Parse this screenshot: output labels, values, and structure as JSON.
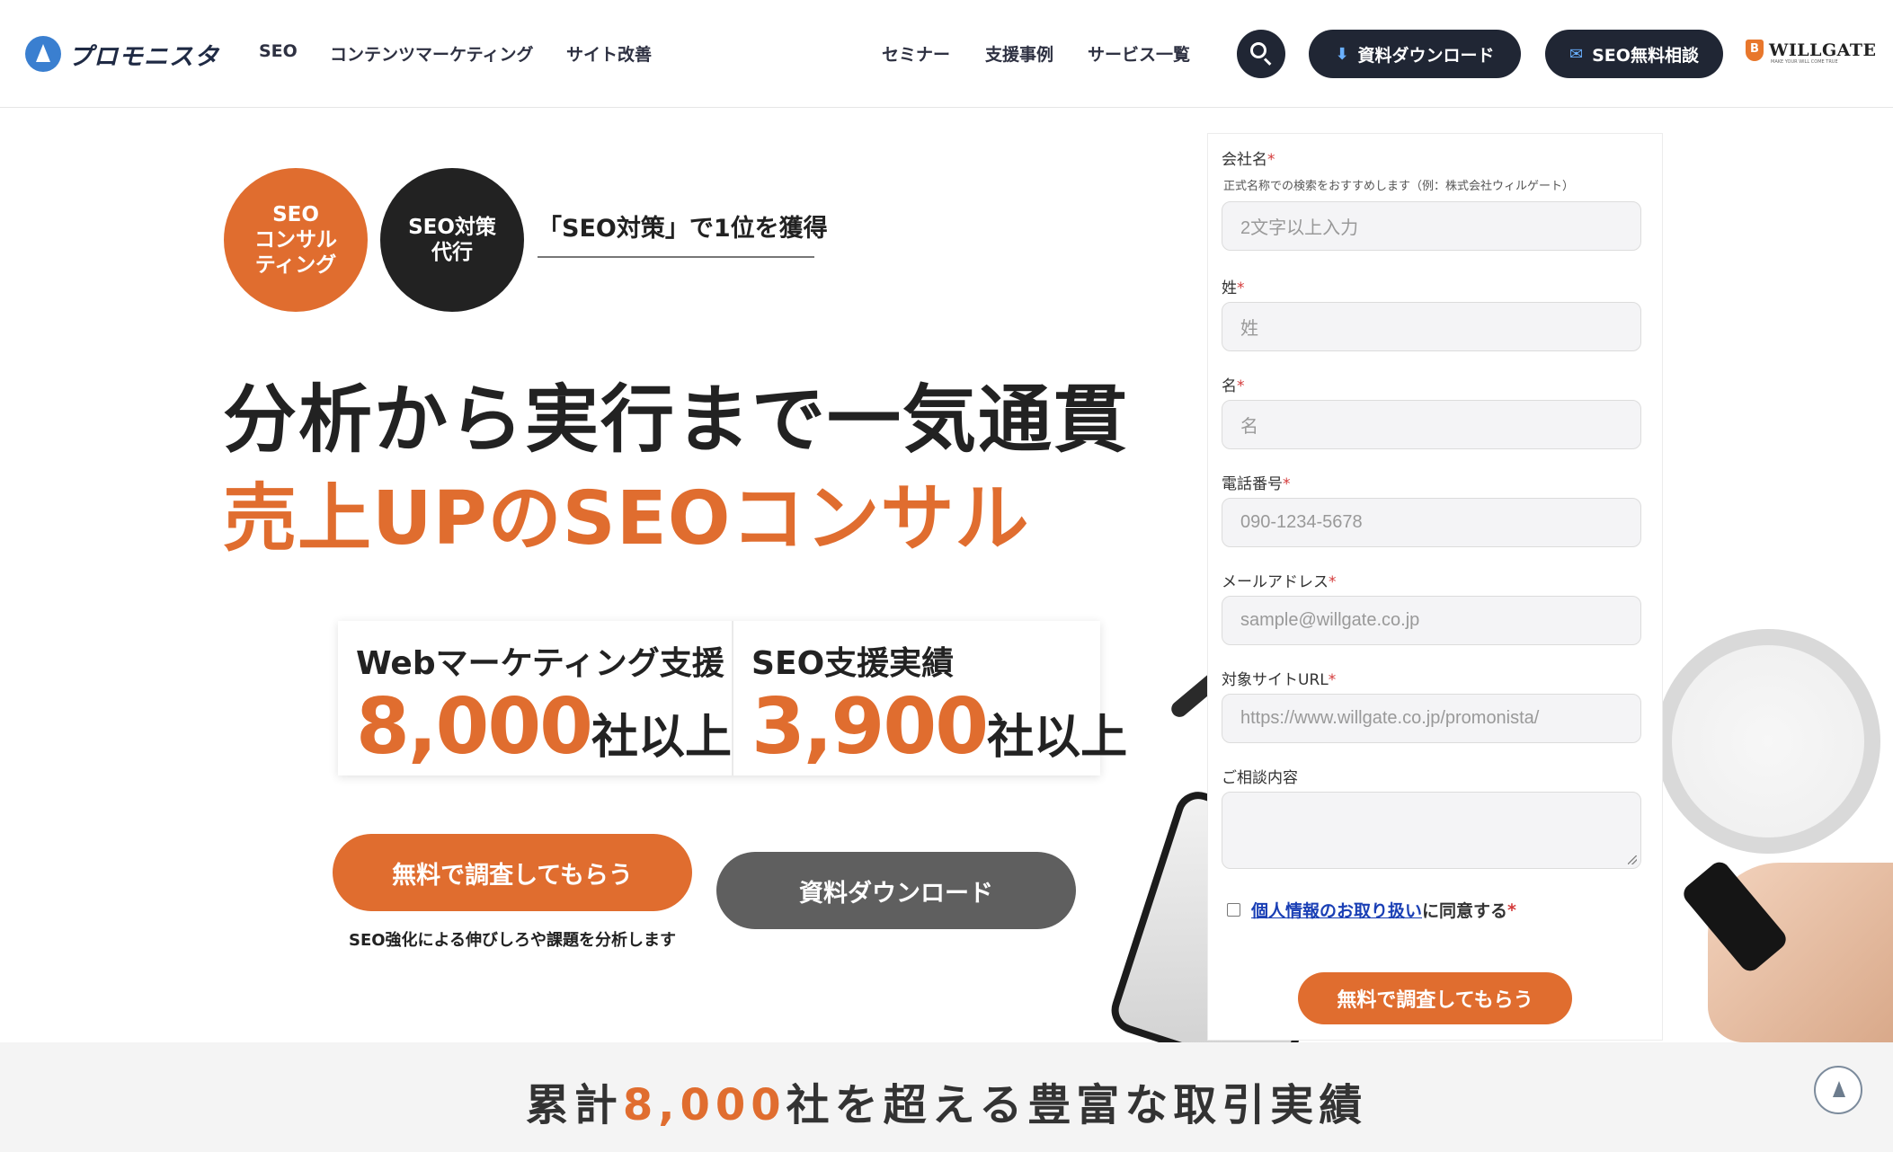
{
  "header": {
    "logo_text": "プロモニスタ",
    "nav_left": [
      "SEO",
      "コンテンツマーケティング",
      "サイト改善"
    ],
    "nav_right": [
      "セミナー",
      "支援事例",
      "サービス一覧"
    ],
    "download_button": "資料ダウンロード",
    "consult_button": "SEO無料相談",
    "company_logo": "WILLGATE",
    "company_tagline": "MAKE YOUR WILL COME TRUE"
  },
  "hero": {
    "badge_orange": "SEO\nコンサル\nティング",
    "badge_black": "SEO対策\n代行",
    "tagline": "「SEO対策」で1位を獲得",
    "headline_line1": "分析から実行まで一気通貫",
    "headline_line2": "売上UPのSEOコンサル",
    "stats": [
      {
        "label": "Webマーケティング支援",
        "number": "8,000",
        "unit": "社以上"
      },
      {
        "label": "SEO支援実績",
        "number": "3,900",
        "unit": "社以上"
      }
    ],
    "cta_primary": "無料で調査してもらう",
    "cta_primary_note": "SEO強化による伸びしろや課題を分析します",
    "cta_secondary": "資料ダウンロード"
  },
  "form": {
    "company_label": "会社名",
    "company_hint": "正式名称での検索をおすすめします（例：株式会社ウィルゲート）",
    "company_placeholder": "2文字以上入力",
    "last_name_label": "姓",
    "last_name_placeholder": "姓",
    "first_name_label": "名",
    "first_name_placeholder": "名",
    "phone_label": "電話番号",
    "phone_placeholder": "090-1234-5678",
    "email_label": "メールアドレス",
    "email_placeholder": "sample@willgate.co.jp",
    "url_label": "対象サイトURL",
    "url_placeholder": "https://www.willgate.co.jp/promonista/",
    "message_label": "ご相談内容",
    "required_mark": "*",
    "consent_link": "個人情報のお取り扱い",
    "consent_tail": "に同意する",
    "submit": "無料で調査してもらう"
  },
  "band": {
    "text_before": "累計",
    "text_highlight": "8,000",
    "text_after": "社を超える豊富な取引実績"
  },
  "colors": {
    "accent": "#e06d2f",
    "dark": "#202634",
    "secondary_button": "#5f5f5f",
    "link": "#1a3fb5"
  },
  "icons": {
    "logo": "promonista-logo-icon",
    "search": "search-icon",
    "download": "download-icon",
    "mail": "mail-icon",
    "back_to_top": "arrow-up-icon"
  }
}
